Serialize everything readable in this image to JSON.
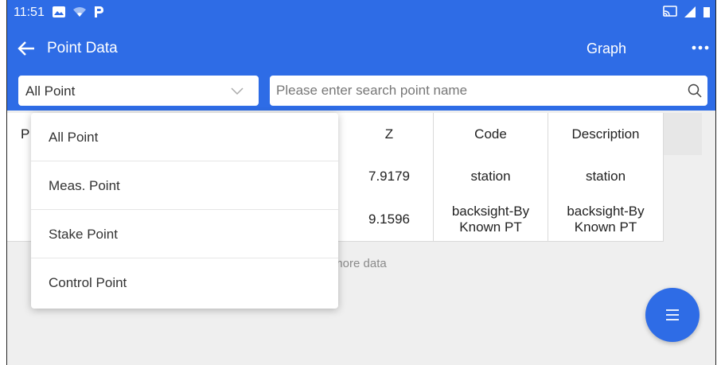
{
  "status_bar": {
    "time": "11:51"
  },
  "header": {
    "back_icon": "arrow-left-icon",
    "title": "Point Data",
    "graph_label": "Graph",
    "more_icon": "more-horizontal-icon"
  },
  "filter": {
    "selected": "All Point"
  },
  "search": {
    "placeholder": "Please enter search point name",
    "value": ""
  },
  "table": {
    "columns": [
      "P",
      "Z",
      "Code",
      "Description"
    ],
    "rows": [
      {
        "z": "7.9179",
        "code": "station",
        "description": "station"
      },
      {
        "z": "9.1596",
        "code": "backsight-By Known PT",
        "description": "backsight-By Known PT"
      }
    ],
    "footer_text": "› more data"
  },
  "dropdown": {
    "options": [
      "All Point",
      "Meas. Point",
      "Stake Point",
      "Control Point"
    ]
  },
  "fab": {
    "icon": "menu-icon"
  },
  "colors": {
    "primary": "#2e6ce6",
    "background": "#efefef"
  }
}
